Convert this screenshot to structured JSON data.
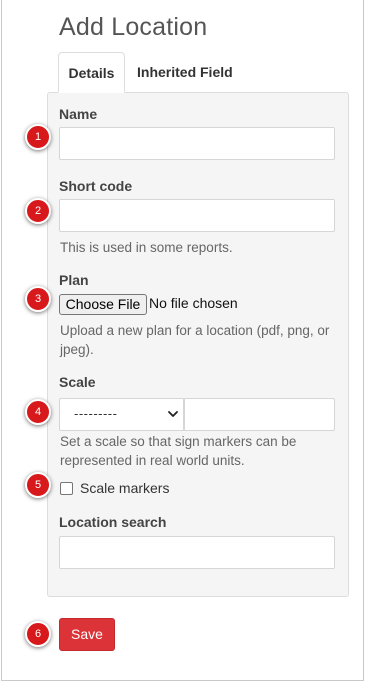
{
  "page": {
    "title": "Add Location"
  },
  "tabs": [
    {
      "label": "Details",
      "active": true
    },
    {
      "label": "Inherited Field Values",
      "active": false
    }
  ],
  "form": {
    "name": {
      "label": "Name",
      "value": ""
    },
    "short_code": {
      "label": "Short code",
      "value": "",
      "help": "This is used in some reports."
    },
    "plan": {
      "label": "Plan",
      "button_label": "Choose File",
      "status": "No file chosen",
      "help_line1": "Upload a new plan for a location (pdf, png, or",
      "help_line2": "jpeg)."
    },
    "scale": {
      "label": "Scale",
      "select_value": "---------",
      "input_value": "",
      "help_line1": "Set a scale so that sign markers can be",
      "help_line2": "represented in real world units."
    },
    "scale_markers": {
      "label": "Scale markers",
      "checked": false
    },
    "location_search": {
      "label": "Location search",
      "value": ""
    },
    "save_label": "Save"
  },
  "markers": [
    "1",
    "2",
    "3",
    "4",
    "5",
    "6"
  ],
  "colors": {
    "accent": "#dc3338",
    "marker": "#d7191c",
    "panel": "#f5f5f5"
  }
}
